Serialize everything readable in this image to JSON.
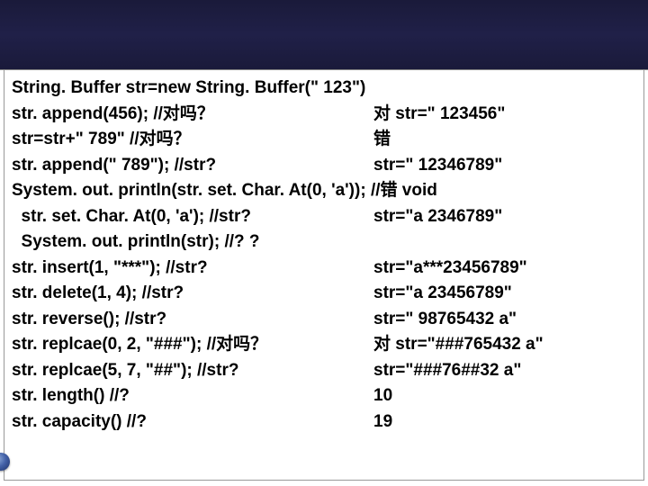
{
  "lines": [
    {
      "left": "String. Buffer str=new String. Buffer(\" 123\")",
      "right": ""
    },
    {
      "left": "str. append(456); //对吗？",
      "right": "对 str=\" 123456\""
    },
    {
      "left": "str=str+\" 789\" //对吗？",
      "right": "错"
    },
    {
      "left": "str. append(\" 789\"); //str?",
      "right": "str=\" 12346789\""
    },
    {
      "full": "System. out. println(str. set. Char. At(0, 'a')); //错 void"
    },
    {
      "left": "  str. set. Char. At(0, 'a'); //str?",
      "right": "str=\"a 2346789\""
    },
    {
      "left": "  System. out. println(str); //? ?",
      "right": ""
    },
    {
      "left": "str. insert(1, \"***\"); //str?",
      "right": "str=\"a***23456789\""
    },
    {
      "left": "str. delete(1, 4); //str?",
      "right": "str=\"a 23456789\""
    },
    {
      "left": "str. reverse(); //str?",
      "right": "str=\" 98765432 a\""
    },
    {
      "left": "str. replcae(0, 2, \"###\"); //对吗？",
      "right": "对 str=\"###765432 a\""
    },
    {
      "left": "str. replcae(5, 7, \"##\"); //str?",
      "right": "str=\"###76##32 a\""
    },
    {
      "left": "str. length() //?",
      "right": "10"
    },
    {
      "left": "str. capacity() //?",
      "right": "19"
    }
  ]
}
